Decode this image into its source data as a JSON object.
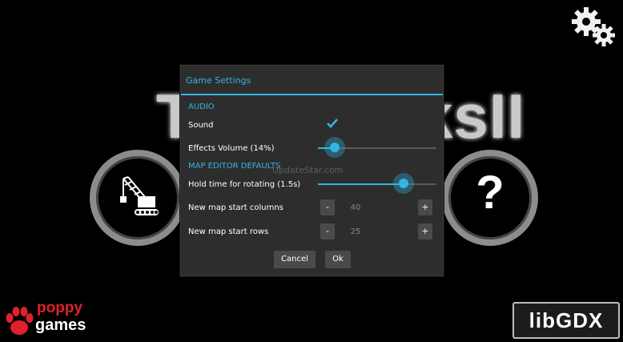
{
  "background": {
    "title_left": "T",
    "title_right": "ksII"
  },
  "icons": {
    "settings": "gears-icon",
    "editor": "crane-icon",
    "help": "question-icon"
  },
  "help_glyph": "?",
  "dialog": {
    "title": "Game Settings",
    "audio_section": "AUDIO",
    "sound_label": "Sound",
    "sound_checked": true,
    "effects_volume_label": "Effects Volume (14%)",
    "effects_volume_value": 0.14,
    "map_editor_section": "MAP EDITOR DEFAULTS",
    "hold_time_label": "Hold time for rotating (1.5s)",
    "hold_time_value": 0.72,
    "columns_label": "New map start columns",
    "columns_value": "40",
    "rows_label": "New map start rows",
    "rows_value": "25",
    "minus": "-",
    "plus": "+",
    "cancel_label": "Cancel",
    "ok_label": "Ok"
  },
  "watermark": "UpdateStar.com",
  "logos": {
    "left_top": "poppy",
    "left_bottom": "games",
    "right": "libGDX"
  },
  "colors": {
    "accent": "#33b5e5",
    "dialog_bg": "#2d2d2d",
    "poppy_red": "#e0202a"
  }
}
